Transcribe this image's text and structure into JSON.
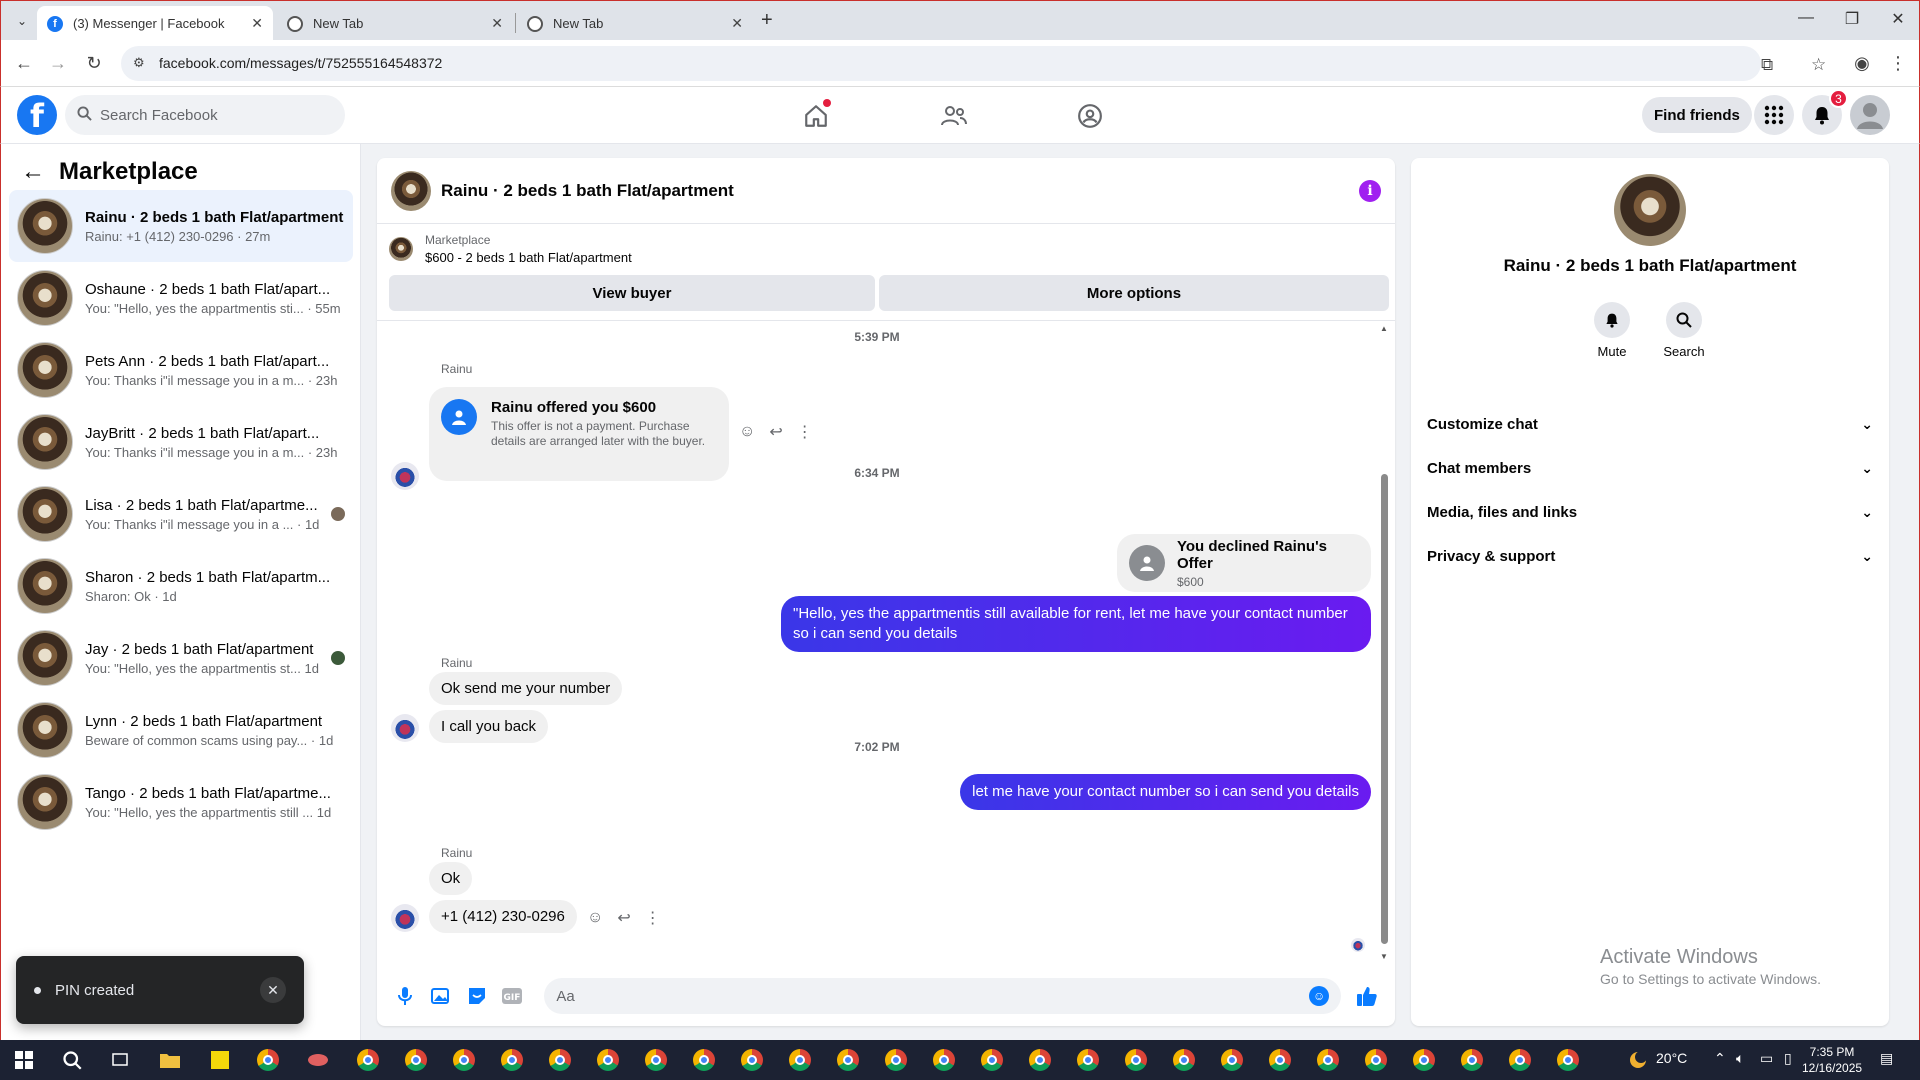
{
  "browser": {
    "tabs": [
      {
        "title": "(3) Messenger | Facebook",
        "favicon": "facebook-icon"
      },
      {
        "title": "New Tab",
        "favicon": "chrome-icon"
      },
      {
        "title": "New Tab",
        "favicon": "chrome-icon"
      }
    ],
    "url": "facebook.com/messages/t/752555164548372"
  },
  "fb_header": {
    "logo": "f",
    "search_placeholder": "Search Facebook",
    "find_friends_label": "Find friends",
    "notification_count": "3"
  },
  "sidebar": {
    "title": "Marketplace",
    "conversations": [
      {
        "name": "Rainu · 2 beds 1 bath Flat/apartment",
        "preview": "Rainu: +1 (412) 230-0296 · 27m",
        "active": true
      },
      {
        "name": "Oshaune · 2 beds 1 bath Flat/apart...",
        "preview": "You: \"Hello, yes the appartmentis sti... · 55m"
      },
      {
        "name": "Pets Ann · 2 beds 1 bath Flat/apart...",
        "preview": "You: Thanks i\"il message you in a m... · 23h"
      },
      {
        "name": "JayBritt · 2 beds 1 bath Flat/apart...",
        "preview": "You: Thanks i\"il message you in a m... · 23h"
      },
      {
        "name": "Lisa · 2 beds 1 bath Flat/apartme...",
        "preview": "You: Thanks i\"il message you in a ... · 1d"
      },
      {
        "name": "Sharon · 2 beds 1 bath Flat/apartm...",
        "preview": "Sharon: Ok · 1d"
      },
      {
        "name": "Jay · 2 beds 1 bath Flat/apartment",
        "preview": "You: \"Hello, yes the appartmentis st... 1d"
      },
      {
        "name": "Lynn · 2 beds 1 bath Flat/apartment",
        "preview": "Beware of common scams using pay... · 1d"
      },
      {
        "name": "Tango · 2 beds 1 bath Flat/apartme...",
        "preview": "You: \"Hello, yes the appartmentis still ... 1d"
      }
    ]
  },
  "toast": {
    "message": "PIN created",
    "close": "✕"
  },
  "chat": {
    "title": "Rainu · 2 beds 1 bath Flat/apartment",
    "marketplace_label": "Marketplace",
    "listing": "$600 - 2 beds 1 bath Flat/apartment",
    "view_buyer": "View buyer",
    "more_options": "More options",
    "ts1": "5:39 PM",
    "sender": "Rainu",
    "offer_title": "Rainu offered you $600",
    "offer_desc": "This offer is not a payment. Purchase details are arranged later with the buyer.",
    "ts2": "6:34 PM",
    "declined_title": "You declined Rainu's Offer",
    "declined_amount": "$600",
    "out_msg1": "\"Hello, yes the appartmentis still available for rent, let me have your contact number so i can send you details",
    "in_msg1": "Ok send me your number",
    "in_msg2": "I call you back",
    "ts3": "7:02 PM",
    "out_msg2": "let me have your contact number so i can send you details",
    "in_msg3": "Ok",
    "in_msg4": "+1 (412) 230-0296",
    "composer_placeholder": "Aa"
  },
  "info_panel": {
    "name": "Rainu · 2 beds 1 bath Flat/apartment",
    "mute_label": "Mute",
    "search_label": "Search",
    "sections": [
      "Customize chat",
      "Chat members",
      "Media, files and links",
      "Privacy & support"
    ],
    "activate_title": "Activate Windows",
    "activate_sub": "Go to Settings to activate Windows."
  },
  "taskbar": {
    "weather": "20°C",
    "time": "7:35 PM",
    "date": "12/16/2025"
  },
  "colors": {
    "fb_blue": "#1877f2",
    "outgoing_gradient_start": "#3a37e8",
    "outgoing_gradient_end": "#6a1bf0",
    "badge_red": "#e41e3f"
  }
}
